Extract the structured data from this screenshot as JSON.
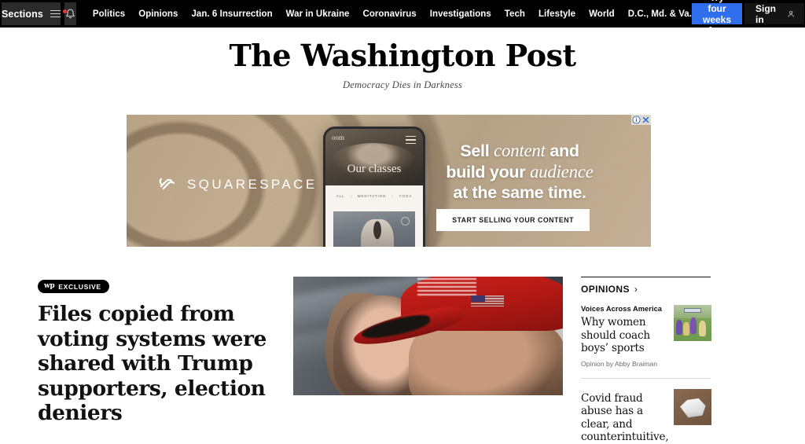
{
  "nav": {
    "sections_label": "Sections",
    "menu_icon": "hamburger-icon",
    "bell_icon": "bell-icon",
    "links": [
      {
        "label": "Politics"
      },
      {
        "label": "Opinions"
      },
      {
        "label": "Jan. 6 Insurrection"
      },
      {
        "label": "War in Ukraine"
      },
      {
        "label": "Coronavirus"
      },
      {
        "label": "Investigations"
      },
      {
        "label": "Tech"
      },
      {
        "label": "Lifestyle"
      },
      {
        "label": "World"
      },
      {
        "label": "D.C., Md. & Va."
      }
    ],
    "subscribe_label": "Try four weeks free",
    "signin_label": "Sign in",
    "account_icon": "person-icon",
    "subscribe_color": "#2f6fed",
    "bar_color": "#000000"
  },
  "masthead": {
    "title": "The Washington Post",
    "tagline": "Democracy Dies in Darkness"
  },
  "ad": {
    "brand": "SQUARESPACE",
    "brand_mark": "squarespace-logo-icon",
    "headline_line1_a": "Sell ",
    "headline_line1_em": "content",
    "headline_line1_b": " and",
    "headline_line2_a": "build your ",
    "headline_line2_em": "audience",
    "headline_line3": "at the same time.",
    "cta_label": "START SELLING YOUR CONTENT",
    "adchoices_icon": "adchoices-info-icon",
    "close_icon": "close-icon",
    "phone": {
      "brand": "oom",
      "hero_title": "Our classes",
      "tabs": [
        "ALL",
        "MEDITATION",
        "YOGA"
      ],
      "menu_icon": "hamburger-icon"
    }
  },
  "lead": {
    "badge_mark": "wp",
    "badge_text": "EXCLUSIVE",
    "headline": "Files copied from voting systems were shared with Trump supporters, election deniers",
    "photo_alt": "woman-and-man-in-red-cap-photo"
  },
  "opinions": {
    "section_label": "OPINIONS",
    "chevron": "›",
    "items": [
      {
        "kicker": "Voices Across America",
        "title": "Why women should coach boys’ sports",
        "byline": "Opinion by Abby Braiman",
        "thumb": "coach-and-kids-thumbnail"
      },
      {
        "kicker": "",
        "title": "Covid fraud abuse has a clear, and counterintuitive,",
        "byline": "",
        "thumb": "face-mask-thumbnail"
      }
    ]
  }
}
